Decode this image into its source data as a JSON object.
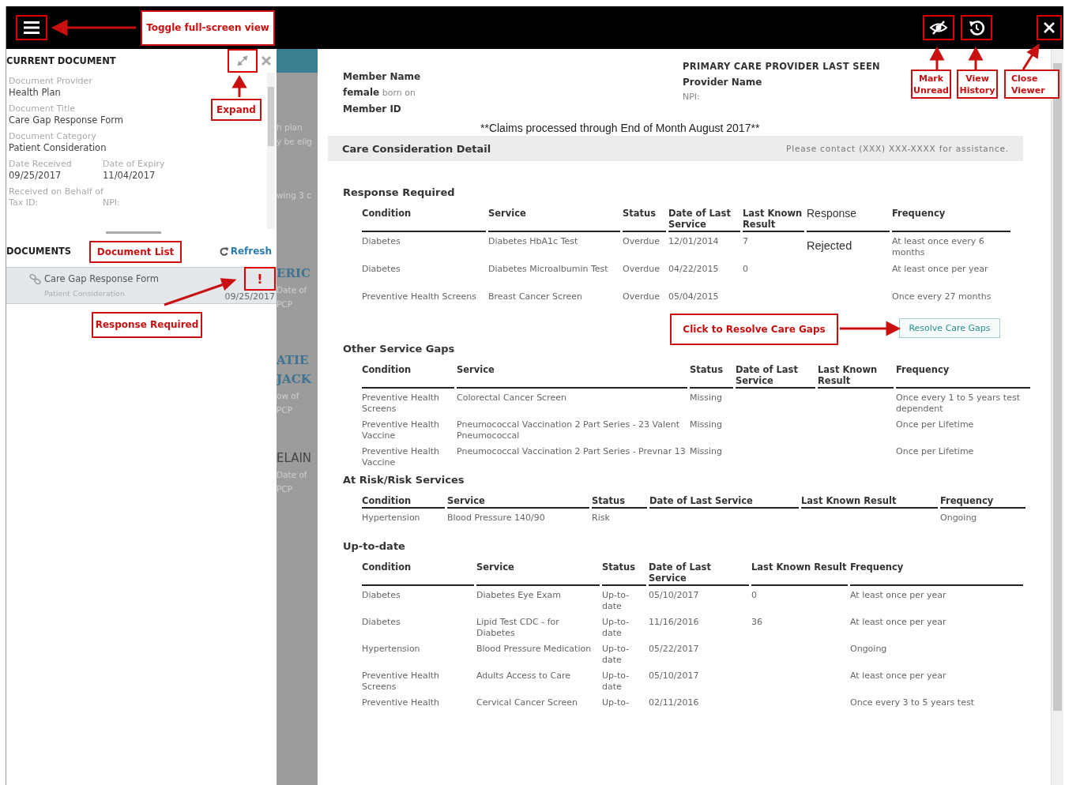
{
  "topbar": {
    "menu_button": {
      "highlighted": true
    },
    "actions": [
      {
        "kind": "mark-unread",
        "highlighted": true
      },
      {
        "kind": "history",
        "highlighted": true
      },
      {
        "kind": "close",
        "highlighted": true
      }
    ]
  },
  "current_document": {
    "title": "CURRENT DOCUMENT",
    "expand_highlighted": true,
    "fields": [
      {
        "kind": "single",
        "label": "Document Provider",
        "value": "Health Plan"
      },
      {
        "kind": "single",
        "label": "Document Title",
        "value": "Care Gap Response Form"
      },
      {
        "kind": "single",
        "label": "Document Category",
        "value": "Patient Consideration"
      },
      {
        "kind": "pair",
        "items": [
          {
            "label": "Date Received",
            "value": "09/25/2017"
          },
          {
            "label": "Date of Expiry",
            "value": "11/04/2017"
          }
        ]
      },
      {
        "kind": "behalf",
        "label": "Received on Behalf of",
        "items": [
          "Tax ID:",
          "NPI:"
        ]
      }
    ]
  },
  "documents": {
    "title": "DOCUMENTS",
    "refresh": "Refresh",
    "items": [
      {
        "title": "Care Gap Response Form",
        "category": "Patient Consideration",
        "date": "09/25/2017",
        "selected": true,
        "alert": "!",
        "alert_highlighted": true
      }
    ]
  },
  "background_fragments": [
    [
      "h plan",
      "y be elig"
    ],
    [
      "wing 3 c"
    ],
    [
      "ERIC",
      "Date of",
      "PCP"
    ],
    [
      "ATIE",
      "JACK",
      "ow of",
      "PCP"
    ],
    [
      "ELAIN",
      "Date of",
      "PCP"
    ]
  ],
  "viewer": {
    "member": {
      "name_label": "Member Name",
      "sex_line": "**female** born on",
      "id_label": "Member ID"
    },
    "provider": {
      "heading": "PRIMARY CARE PROVIDER LAST SEEN",
      "name_label": "Provider Name",
      "npi": "NPI:"
    },
    "claims_note": "**Claims processed through End of Month August 2017**",
    "detail_bar": {
      "title": "Care Consideration Detail",
      "contact": "Please contact (XXX) XXX-XXXX for assistance."
    },
    "sections": [
      {
        "title": "Response Required",
        "columns": [
          {
            "label": "Condition"
          },
          {
            "label": "Service"
          },
          {
            "label": "Status"
          },
          {
            "label": "Date of Last Service"
          },
          {
            "label": "Last Known Result"
          },
          {
            "label": "Response",
            "kind": "response"
          },
          {
            "label": "Frequency"
          }
        ],
        "rows": [
          [
            "Diabetes",
            "Diabetes HbA1c Test",
            "Overdue",
            "12/01/2014",
            "7",
            "Rejected",
            "At least once every 6 months"
          ],
          [
            "Diabetes",
            "Diabetes Microalbumin Test",
            "Overdue",
            "04/22/2015",
            "0",
            null,
            "At least once per year"
          ],
          [
            "Preventive Health Screens",
            "Breast Cancer Screen",
            "Overdue",
            "05/04/2015",
            null,
            null,
            "Once every 27 months"
          ]
        ],
        "action": {
          "label": "Resolve Care Gaps"
        }
      },
      {
        "title": "Other Service Gaps",
        "columns": [
          {
            "label": "Condition"
          },
          {
            "label": "Service"
          },
          {
            "label": "Status"
          },
          {
            "label": "Date of Last Service"
          },
          {
            "label": "Last Known Result"
          },
          {
            "label": "Frequency"
          }
        ],
        "rows": [
          [
            "Preventive Health Screens",
            "Colorectal Cancer Screen",
            "Missing",
            null,
            null,
            "Once every 1 to 5 years test dependent"
          ],
          [
            "Preventive Health Vaccine",
            "Pneumococcal Vaccination 2 Part Series - 23 Valent Pneumococcal",
            "Missing",
            null,
            null,
            "Once per Lifetime"
          ],
          [
            "Preventive Health Vaccine",
            "Pneumococcal Vaccination 2 Part Series - Prevnar 13",
            "Missing",
            null,
            null,
            "Once per Lifetime"
          ]
        ]
      },
      {
        "title": "At Risk/Risk Services",
        "columns": [
          {
            "label": "Condition"
          },
          {
            "label": "Service"
          },
          {
            "label": "Status"
          },
          {
            "label": "Date of Last Service"
          },
          {
            "label": "Last Known Result"
          },
          {
            "label": "Frequency"
          }
        ],
        "rows": [
          [
            "Hypertension",
            "Blood Pressure 140/90",
            "Risk",
            null,
            null,
            "Ongoing"
          ]
        ]
      },
      {
        "title": "Up-to-date",
        "columns": [
          {
            "label": "Condition"
          },
          {
            "label": "Service"
          },
          {
            "label": "Status"
          },
          {
            "label": "Date of Last Service"
          },
          {
            "label": "Last Known Result"
          },
          {
            "label": "Frequency"
          }
        ],
        "rows": [
          [
            "Diabetes",
            "Diabetes Eye Exam",
            "Up-to-date",
            "05/10/2017",
            "0",
            "At least once per year"
          ],
          [
            "Diabetes",
            "Lipid Test CDC - for Diabetes",
            "Up-to-date",
            "11/16/2016",
            "36",
            "At least once per year"
          ],
          [
            "Hypertension",
            "Blood Pressure Medication",
            "Up-to-date",
            "05/22/2017",
            null,
            "Ongoing"
          ],
          [
            "Preventive Health Screens",
            "Adults Access to Care",
            "Up-to-date",
            "05/10/2017",
            null,
            "At least once per year"
          ],
          [
            "Preventive Health",
            "Cervical Cancer Screen",
            "Up-to-",
            "02/11/2016",
            null,
            "Once every 3 to 5 years test"
          ]
        ]
      }
    ]
  },
  "annotations": [
    {
      "text": "Toggle full-screen view"
    },
    {
      "text": "Expand"
    },
    {
      "text": "Document List"
    },
    {
      "text": "Response Required"
    },
    {
      "text": "Mark Unread"
    },
    {
      "text": "View History"
    },
    {
      "text": "Close Viewer"
    },
    {
      "text": "Click to Resolve Care Gaps"
    }
  ]
}
